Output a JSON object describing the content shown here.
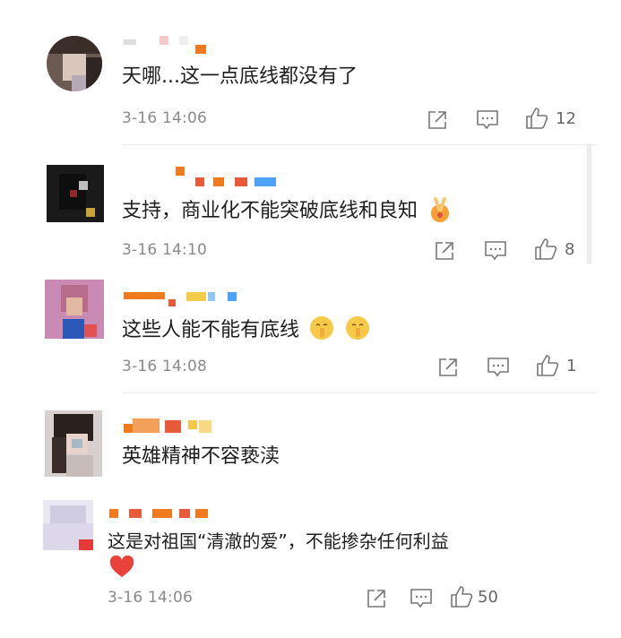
{
  "comments": [
    {
      "text": "天哪...这一点底线都没有了",
      "time": "3-16 14:06",
      "likes": "12"
    },
    {
      "text": "支持，商业化不能突破底线和良知",
      "time": "3-16 14:10",
      "likes": "8"
    },
    {
      "text": "这些人能不能有底线",
      "time": "3-16 14:08",
      "likes": "1"
    },
    {
      "text": "英雄精神不容亵渎"
    },
    {
      "text": "这是对祖国“清澈的爱”，不能掺杂任何利益",
      "time": "3-16 14:06",
      "likes": "50"
    }
  ],
  "icons": {
    "share": "share-icon",
    "comment": "comment-icon",
    "like": "thumbs-up-icon",
    "emoji_thinking": "shushing-face-emoji",
    "emoji_hands": "praying-hands-emoji",
    "emoji_heart": "red-heart-emoji"
  },
  "colors": {
    "accent_orange": "#f07a1e",
    "accent_blue": "#4fa3f7",
    "text_gray": "#8a8a8a",
    "heart_red": "#e8403b"
  }
}
